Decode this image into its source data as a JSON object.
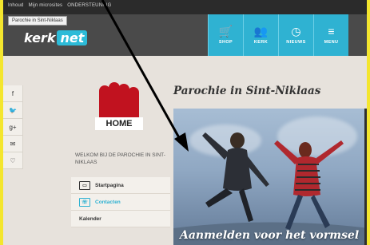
{
  "topbar": {
    "links": [
      "Inhoud",
      "Mijn microsites",
      "ONDERSTEUNING"
    ]
  },
  "tooltip": "Parochie in Sint-Niklaas",
  "logo": {
    "part1": "kerk",
    "part2": "net"
  },
  "nav": [
    {
      "label": "SHOP",
      "icon": "cart-icon",
      "glyph": "🛒"
    },
    {
      "label": "KERK",
      "icon": "people-icon",
      "glyph": "👥"
    },
    {
      "label": "NIEUWS",
      "icon": "clock-icon",
      "glyph": "◷"
    },
    {
      "label": "MENU",
      "icon": "menu-icon",
      "glyph": "≡"
    }
  ],
  "social": [
    {
      "icon": "facebook-icon",
      "glyph": "f"
    },
    {
      "icon": "twitter-icon",
      "glyph": "🐦"
    },
    {
      "icon": "google-plus-icon",
      "glyph": "g+"
    },
    {
      "icon": "mail-icon",
      "glyph": "✉"
    },
    {
      "icon": "heart-icon",
      "glyph": "♡"
    }
  ],
  "home_logo_label": "HOME",
  "welcome": "WELKOM BIJ DE PAROCHIE IN SINT-NIKLAAS",
  "menu": [
    {
      "label": "Startpagina",
      "active": false,
      "glyph": "▭"
    },
    {
      "label": "Contacten",
      "active": true,
      "glyph": "☏"
    },
    {
      "label": "Kalender",
      "active": false,
      "glyph": ""
    }
  ],
  "page_title": "Parochie in Sint-Niklaas",
  "photo_caption": "Aanmelden voor het vormsel",
  "colors": {
    "accent": "#2fb2d2",
    "brand_red": "#c1121f",
    "frame_yellow": "#f4e62e"
  }
}
